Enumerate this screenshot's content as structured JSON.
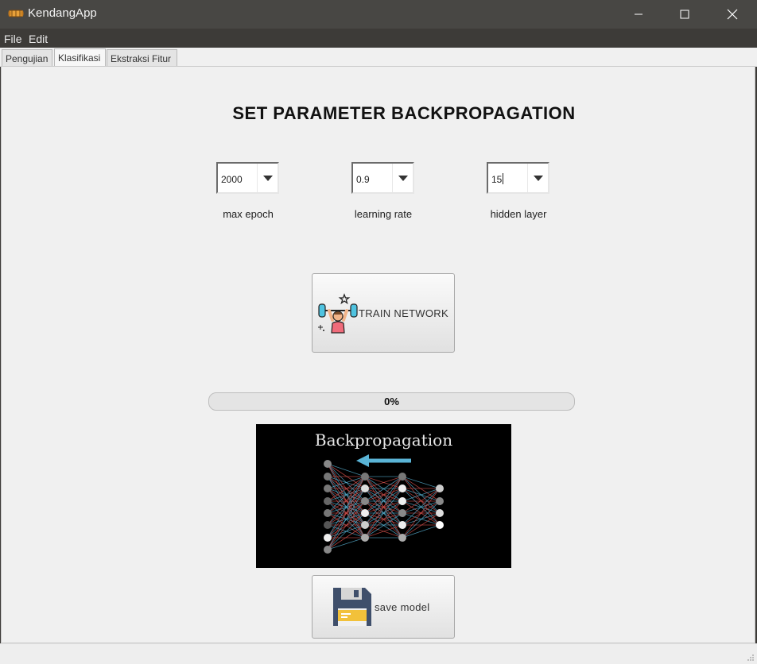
{
  "window": {
    "title": "KendangApp",
    "icon": "drum-icon",
    "controls": [
      "minimize",
      "maximize",
      "close"
    ]
  },
  "menu": {
    "items": [
      "File",
      "Edit"
    ]
  },
  "tabs": [
    {
      "label": "Pengujian",
      "active": false
    },
    {
      "label": "Klasifikasi",
      "active": true
    },
    {
      "label": "Ekstraksi Fitur",
      "active": false
    }
  ],
  "main": {
    "heading": "SET PARAMETER BACKPROPAGATION",
    "params": [
      {
        "label": "max epoch",
        "value": "2000"
      },
      {
        "label": "learning rate",
        "value": "0.9"
      },
      {
        "label": "hidden layer",
        "value": "15"
      }
    ],
    "train_button": {
      "label": "TRAIN NETWORK",
      "icon": "weightlifter-icon"
    },
    "progress": {
      "label": "0%",
      "value": 0
    },
    "image": {
      "title": "Backpropagation"
    },
    "save_button": {
      "label": "save model",
      "icon": "floppy-disk-icon"
    }
  },
  "colors": {
    "progress_fill": "#06b025",
    "diagram_arrow": "#5ab4d6",
    "diagram_red": "#d9534f",
    "diagram_blue": "#5ab4d6"
  }
}
